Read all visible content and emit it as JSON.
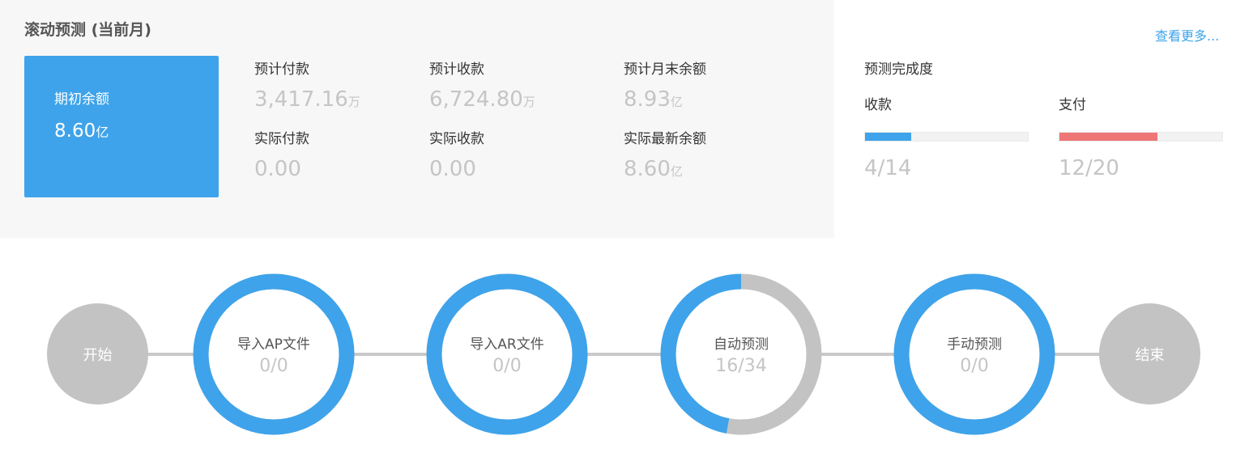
{
  "summary": {
    "title": "滚动预测 (当前月)",
    "opening_balance": {
      "label": "期初余额",
      "value": "8.60",
      "unit": "亿"
    },
    "metrics": [
      {
        "label": "预计付款",
        "value": "3,417.16",
        "unit": "万"
      },
      {
        "label": "预计收款",
        "value": "6,724.80",
        "unit": "万"
      },
      {
        "label": "预计月末余额",
        "value": "8.93",
        "unit": "亿"
      },
      {
        "label": "实际付款",
        "value": "0.00",
        "unit": ""
      },
      {
        "label": "实际收款",
        "value": "0.00",
        "unit": ""
      },
      {
        "label": "实际最新余额",
        "value": "8.60",
        "unit": "亿"
      }
    ]
  },
  "more_link": "查看更多...",
  "completion": {
    "title": "预测完成度",
    "items": [
      {
        "label": "收款",
        "count": "4/14",
        "done": 4,
        "total": 14,
        "color": "#3ea3ea"
      },
      {
        "label": "支付",
        "count": "12/20",
        "done": 12,
        "total": 20,
        "color": "#ee7676"
      }
    ]
  },
  "flow": {
    "start": "开始",
    "end": "结束",
    "steps": [
      {
        "label": "导入AP文件",
        "count": "0/0",
        "done": 0,
        "total": 0
      },
      {
        "label": "导入AR文件",
        "count": "0/0",
        "done": 0,
        "total": 0
      },
      {
        "label": "自动预测",
        "count": "16/34",
        "done": 16,
        "total": 34
      },
      {
        "label": "手动预测",
        "count": "0/0",
        "done": 0,
        "total": 0
      }
    ],
    "colors": {
      "ring_done": "#3ea3ea",
      "ring_remaining": "#c3c3c3",
      "endpoint": "#c3c3c3"
    }
  }
}
